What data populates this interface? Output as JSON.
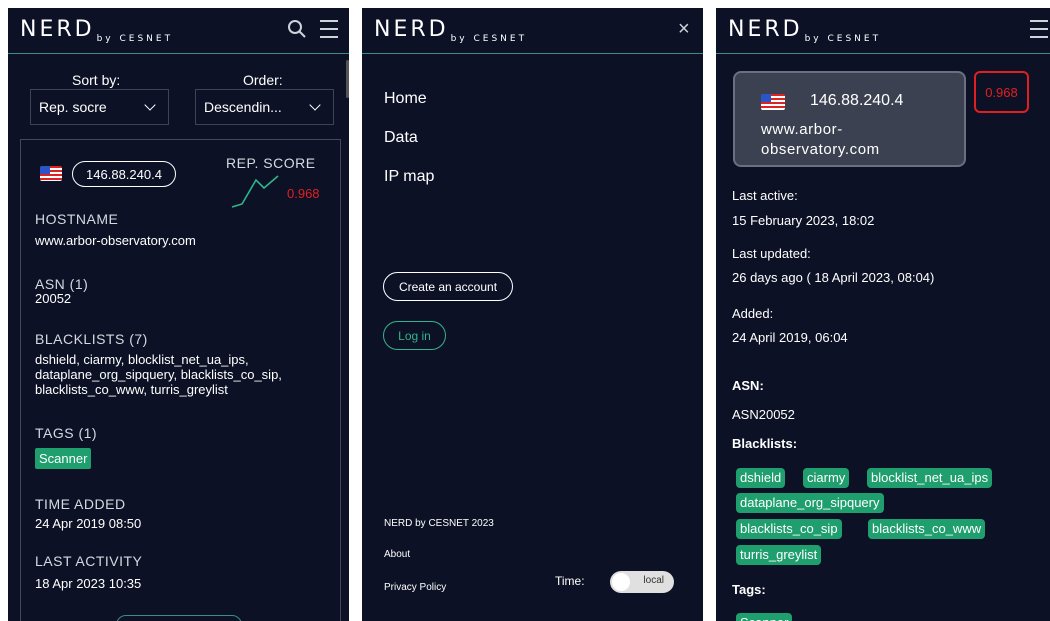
{
  "left_panel": {
    "logo": "NERD",
    "logo_sub": "by CESNET",
    "sort_label": "Sort by:",
    "sort_value": "Rep. socre",
    "order_label": "Order:",
    "order_value": "Descendin...",
    "ip": "146.88.240.4",
    "rep_score_label": "REP. SCORE",
    "rep_score_value": "0.968",
    "hostname_label": "HOSTNAME",
    "hostname_value": "www.arbor-observatory.com",
    "asn_label": "ASN (1)",
    "asn_value": "20052",
    "blacklists_label": "BLACKLISTS (7)",
    "blacklists_line1": "dshield, ciarmy, blocklist_net_ua_ips,",
    "blacklists_line2": "dataplane_org_sipquery, blacklists_co_sip,",
    "blacklists_line3": "blacklists_co_www, turris_greylist",
    "tags_label": "TAGS (1)",
    "tag": "Scanner",
    "time_added_label": "TIME ADDED",
    "time_added_value": "24 Apr 2019 08:50",
    "last_activity_label": "LAST ACTIVITY",
    "last_activity_value": "18 Apr 2023 10:35"
  },
  "menu_panel": {
    "logo": "NERD",
    "logo_sub": "by CESNET",
    "close": "×",
    "items": [
      "Home",
      "Data",
      "IP map"
    ],
    "create_account": "Create an account",
    "login": "Log in",
    "copyright": "NERD by CESNET 2023",
    "about": "About",
    "privacy": "Privacy Policy",
    "time_label": "Time:",
    "time_toggle": "local"
  },
  "detail_panel": {
    "logo": "NERD",
    "logo_sub": "by CESNET",
    "ip": "146.88.240.4",
    "host_line1": "www.arbor-",
    "host_line2": "observatory.com",
    "score": "0.968",
    "last_active_label": "Last active:",
    "last_active_value": "15 February 2023, 18:02",
    "last_updated_label": "Last updated:",
    "last_updated_value": "26 days ago ( 18 April 2023, 08:04)",
    "added_label": "Added:",
    "added_value": "24 April 2019, 06:04",
    "asn_label": "ASN:",
    "asn_value": "ASN20052",
    "blacklists_label": "Blacklists:",
    "blacklists": [
      "dshield",
      "ciarmy",
      "blocklist_net_ua_ips",
      "dataplane_org_sipquery",
      "blacklists_co_sip",
      "blacklists_co_www",
      "turris_greylist"
    ],
    "tags_label": "Tags:",
    "tag": "Scanner"
  },
  "colors": {
    "background": "#0d1125",
    "accent": "#1f9e6e",
    "danger": "#e02020"
  },
  "icons": {
    "search": "search-icon",
    "menu": "hamburger-icon",
    "close": "close-icon",
    "flag": "us-flag-icon"
  }
}
